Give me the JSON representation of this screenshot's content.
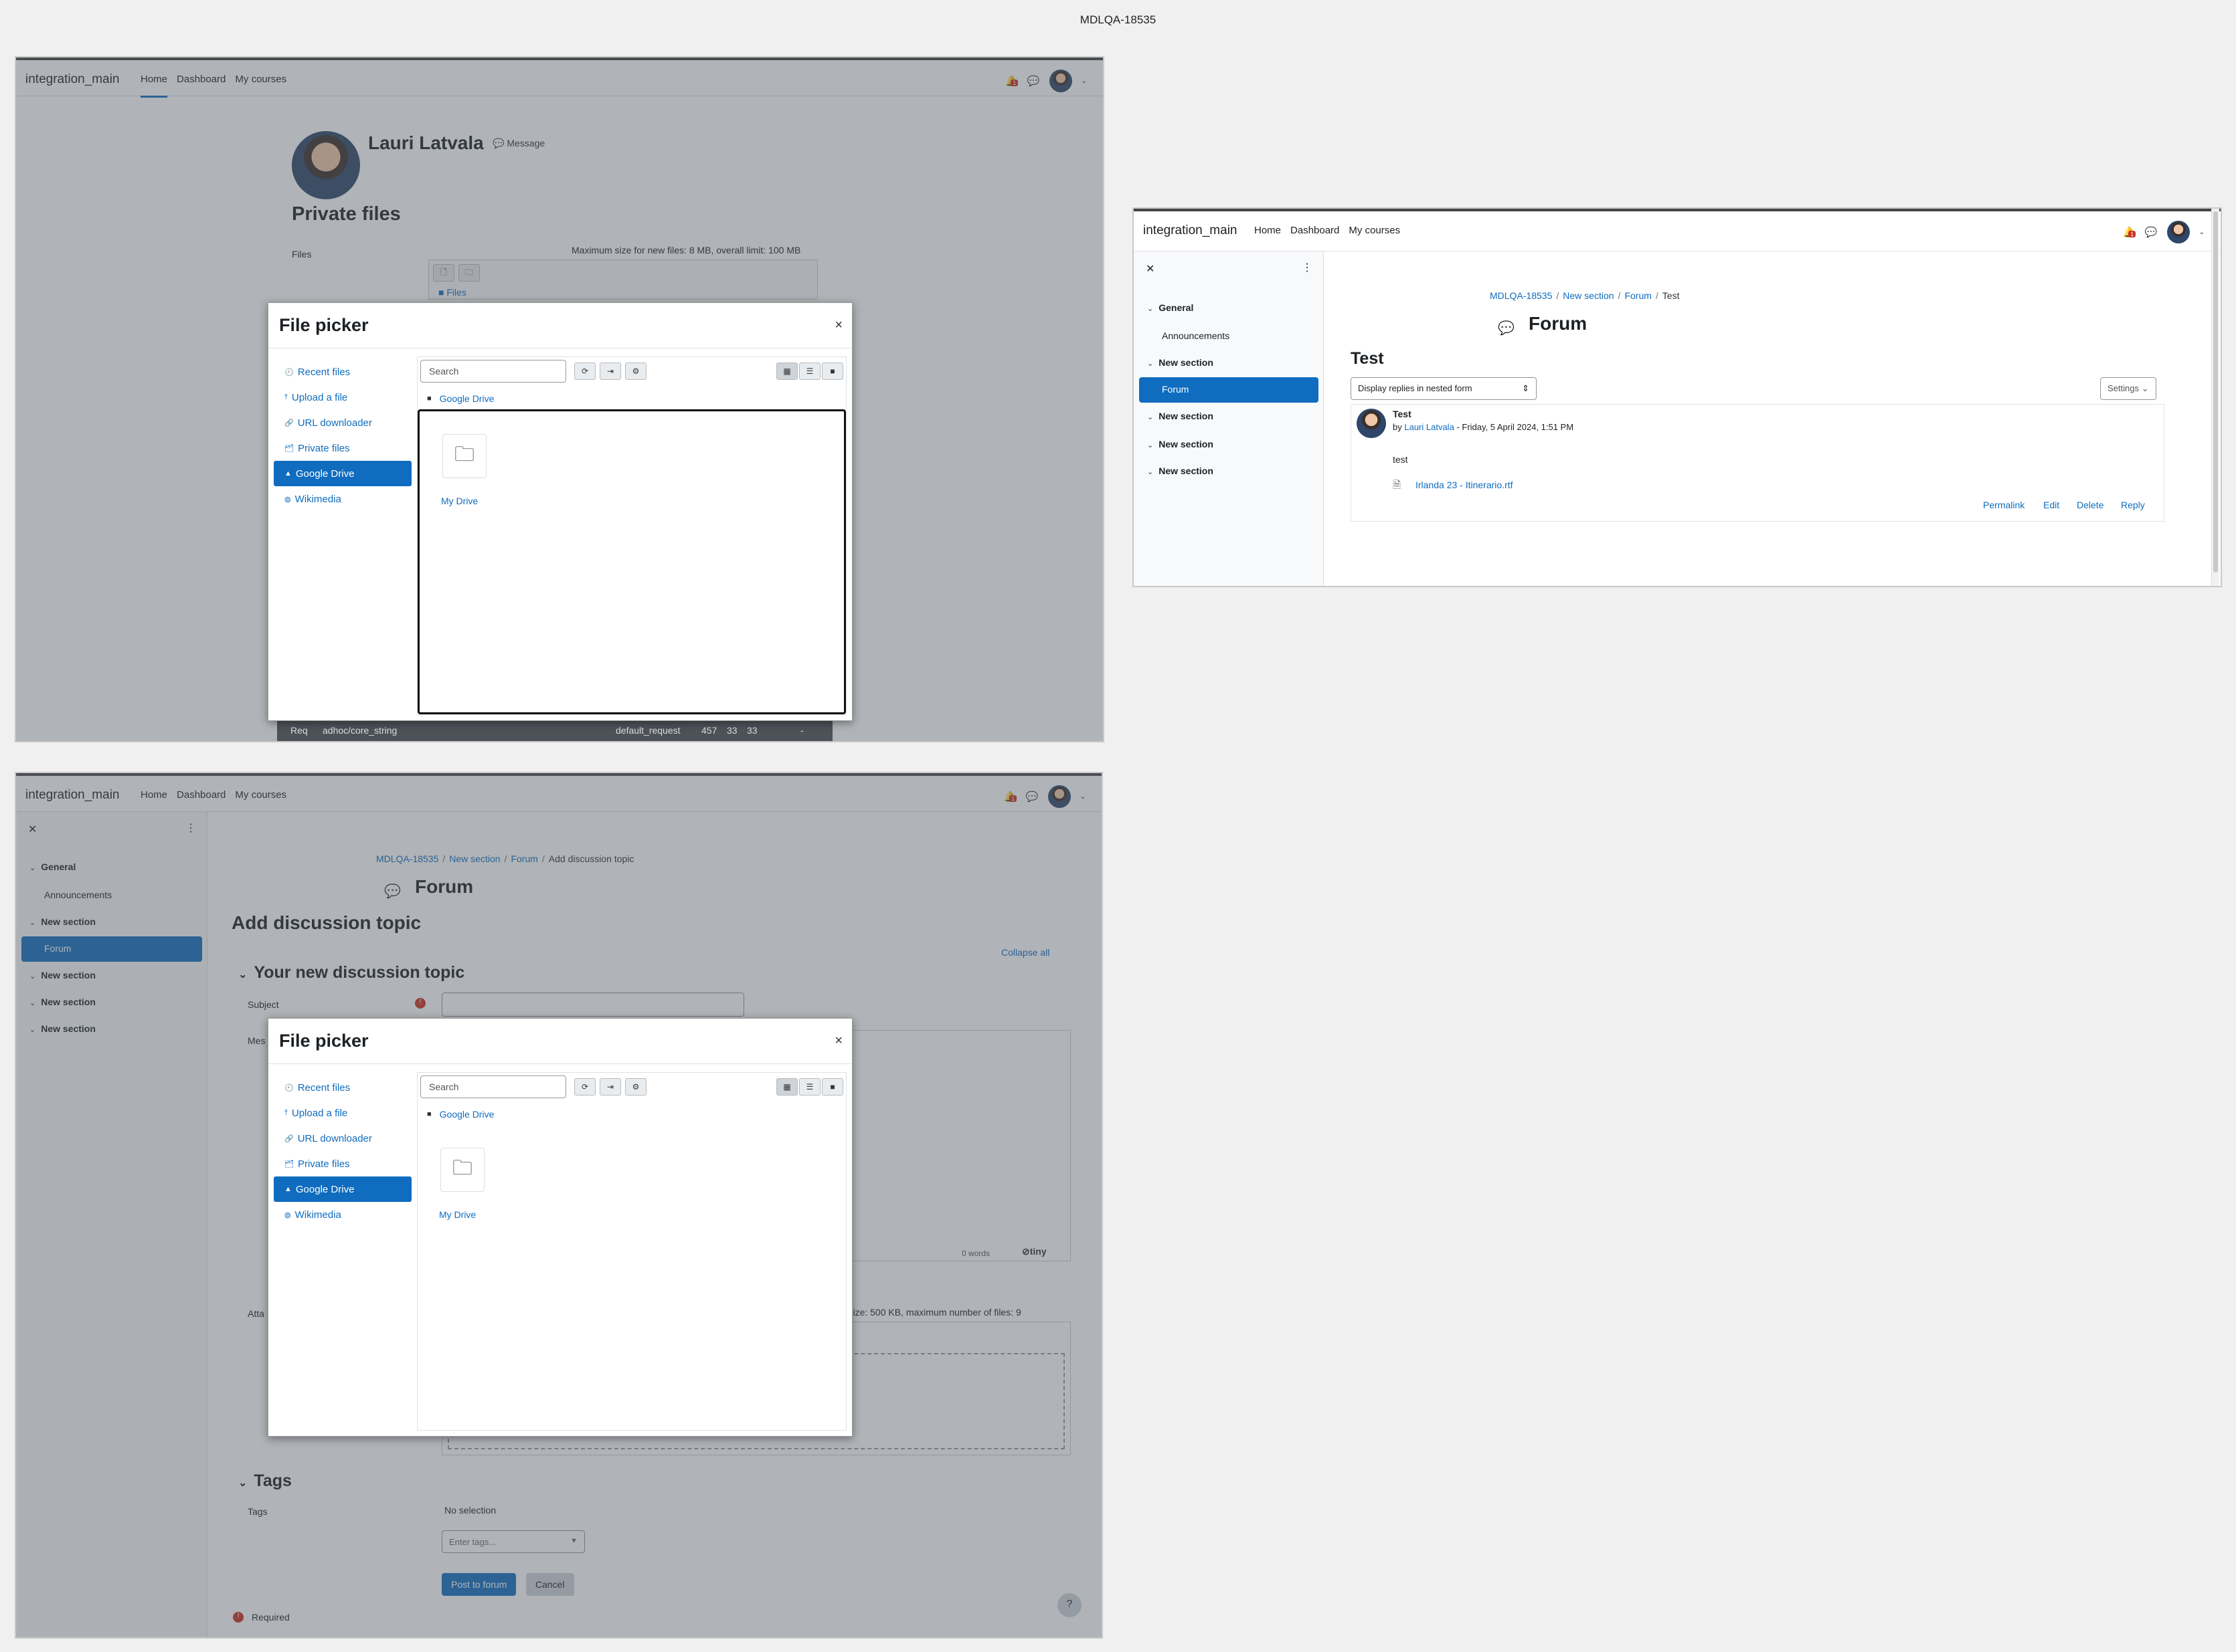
{
  "page_title": "MDLQA-18535",
  "site_name": "integration_main",
  "nav": {
    "home": "Home",
    "dashboard": "Dashboard",
    "my_courses": "My courses"
  },
  "notif_count": "1",
  "profile": {
    "name": "Lauri Latvala",
    "message": "Message",
    "heading": "Private files",
    "files_label": "Files",
    "limits": "Maximum size for new files: 8 MB, overall limit: 100 MB",
    "files_path": "Files"
  },
  "file_picker": {
    "title": "File picker",
    "repos": [
      "Recent files",
      "Upload a file",
      "URL downloader",
      "Private files",
      "Google Drive",
      "Wikimedia"
    ],
    "selected": "Google Drive",
    "search_placeholder": "Search",
    "path": "Google Drive",
    "folder": "My Drive"
  },
  "debug_bar": {
    "req": "Req",
    "component": "adhoc/core_string",
    "type": "default_request",
    "n1": "457",
    "n2": "33",
    "n3": "33",
    "n4": "-"
  },
  "course_index": {
    "sections": [
      "General",
      "New section",
      "New section",
      "New section",
      "New section"
    ],
    "announcements": "Announcements",
    "forum": "Forum"
  },
  "discussion": {
    "breadcrumb": [
      "MDLQA-18535",
      "New section",
      "Forum",
      "Test"
    ],
    "activity": "Forum",
    "title": "Test",
    "display_mode": "Display replies in nested form",
    "settings": "Settings",
    "post_subject": "Test",
    "post_by": "by",
    "post_author": "Lauri Latvala",
    "post_date": "- Friday, 5 April 2024, 1:51 PM",
    "post_body": "test",
    "attachment": "Irlanda 23 - Itinerario.rtf",
    "actions": [
      "Permalink",
      "Edit",
      "Delete",
      "Reply"
    ]
  },
  "add_topic": {
    "breadcrumb": [
      "MDLQA-18535",
      "New section",
      "Forum",
      "Add discussion topic"
    ],
    "activity": "Forum",
    "heading": "Add discussion topic",
    "collapse_all": "Collapse all",
    "section": "Your new discussion topic",
    "subject_label": "Subject",
    "message_label": "Mes",
    "attach_label": "Atta",
    "word_count": "0 words",
    "tiny": "tiny",
    "attach_limits": "a file size: 500 KB, maximum number of files: 9",
    "tags_heading": "Tags",
    "tags_label": "Tags",
    "no_selection": "No selection",
    "enter_tags": "Enter tags...",
    "post_button": "Post to forum",
    "cancel_button": "Cancel",
    "required": "Required",
    "help": "?"
  }
}
